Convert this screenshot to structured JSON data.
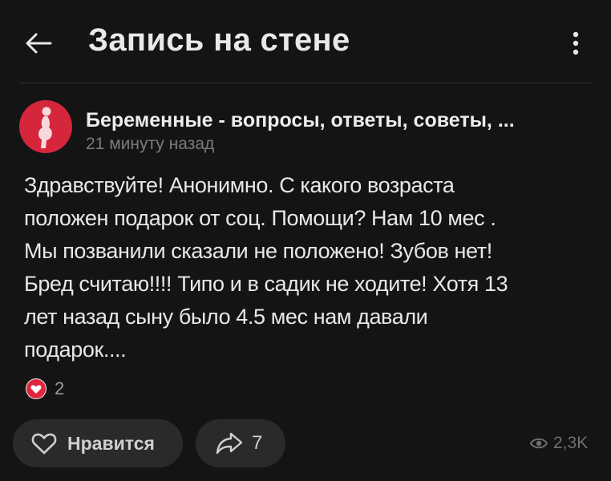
{
  "header": {
    "title": "Запись на стене",
    "back_icon": "arrow-left-icon",
    "menu_icon": "more-vertical-icon"
  },
  "post": {
    "community_name": "Беременные - вопросы, ответы, советы, ...",
    "time": "21 минуту назад",
    "text_lines": [
      "Здравствуйте! Анонимно. С какого возраста",
      "положен подарок от соц. Помощи? Нам 10 мес .",
      "Мы позванили сказали не положено! Зубов нет!",
      "Бред считаю!!!! Типо и в садик не ходите! Хотя 13",
      "лет назад сыну было 4.5 мес нам давали",
      "подарок...."
    ],
    "reactions": {
      "icon": "heart-reaction-icon",
      "count": "2",
      "color": "#e0263f"
    }
  },
  "actions": {
    "like_label": "Нравится",
    "share_count": "7",
    "views_count": "2,3K"
  },
  "colors": {
    "background": "#141414",
    "pill": "#2a2a2a",
    "avatar": "#d5263c"
  }
}
